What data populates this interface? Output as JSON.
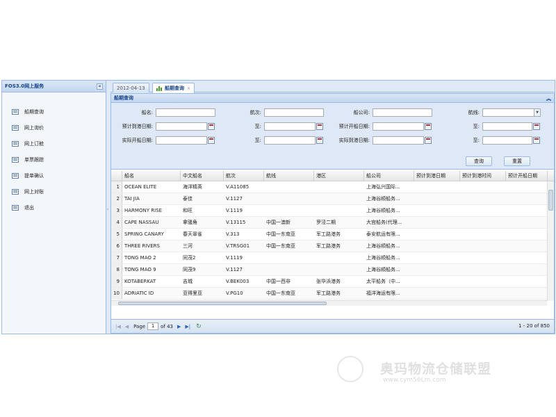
{
  "sidebar": {
    "title": "FOS3.0网上服务",
    "collapse_glyph": "«",
    "items": [
      {
        "label": "船期查询"
      },
      {
        "label": "网上询价"
      },
      {
        "label": "网上订舱"
      },
      {
        "label": "单票跟踪"
      },
      {
        "label": "提单确认"
      },
      {
        "label": "网上对账"
      },
      {
        "label": "退出"
      }
    ]
  },
  "tabs": [
    {
      "label": "2012-04-13"
    },
    {
      "label": "船期查询",
      "close": "×"
    }
  ],
  "panel": {
    "title": "船期查询",
    "collapse_glyph": "︽"
  },
  "form": {
    "vessel_name_label": "船名:",
    "voyage_label": "航次:",
    "carrier_label": "船公司:",
    "route_label": "航线:",
    "eta_from_label": "预计到港日期:",
    "to_label_1": "至:",
    "etd_from_label": "预计开船日期:",
    "to_label_2": "至:",
    "atd_from_label": "实际开船日期:",
    "to_label_3": "至:",
    "ata_from_label": "实际到港日期:",
    "to_label_4": "至:",
    "query_button": "查询",
    "reset_button": "重置"
  },
  "grid": {
    "columns": [
      "",
      "船名",
      "中文船名",
      "航次",
      "航线",
      "港区",
      "船公司",
      "预计到港日期",
      "预计到港时间",
      "预计开船日期"
    ],
    "rows": [
      [
        "1",
        "OCEAN ELITE",
        "海洋精英",
        "V.A11085",
        "",
        "",
        "上海弘兴国际..."
      ],
      [
        "2",
        "TAI JIA",
        "泰佳",
        "V.1127",
        "",
        "",
        "上海谷顺船务..."
      ],
      [
        "3",
        "HARMONY RISE",
        "和旺",
        "V.1119",
        "",
        "",
        "上海谷顺船务..."
      ],
      [
        "4",
        "CAPE NASSAU",
        "拿骚角",
        "V.13115",
        "中国一澳新",
        "罗泾二期",
        "大宫船务(代理..."
      ],
      [
        "5",
        "SPRING CANARY",
        "春天翠雀",
        "V.313",
        "中国一东南亚",
        "军工路港务",
        "泰安航运有限..."
      ],
      [
        "6",
        "THREE RIVERS",
        "三河",
        "V.TRSG01",
        "中国一东南亚",
        "军工路港务",
        "上海谷顺船务..."
      ],
      [
        "7",
        "TONG MAO 2",
        "同茂2",
        "V.1119",
        "",
        "",
        "上海谷顺船务..."
      ],
      [
        "8",
        "TONG MAO 9",
        "同茂9",
        "V.1127",
        "",
        "",
        "上海谷顺船务..."
      ],
      [
        "9",
        "KOTABERKAT",
        "吉城",
        "V.BEK003",
        "中国一西非",
        "张华浜港务",
        "太平船务（中..."
      ],
      [
        "10",
        "ADRIATIC ID",
        "亚得里亚",
        "V.PG10",
        "中国一东南亚",
        "军工路港务",
        "福洋海运有限..."
      ]
    ]
  },
  "pager": {
    "page_label": "Page",
    "page_value": "1",
    "of_label": "of 43",
    "info": "1 - 20 of 850"
  },
  "watermark": {
    "name": "奥玛物流仓储联盟",
    "url": "www.cym56Lm.com"
  }
}
